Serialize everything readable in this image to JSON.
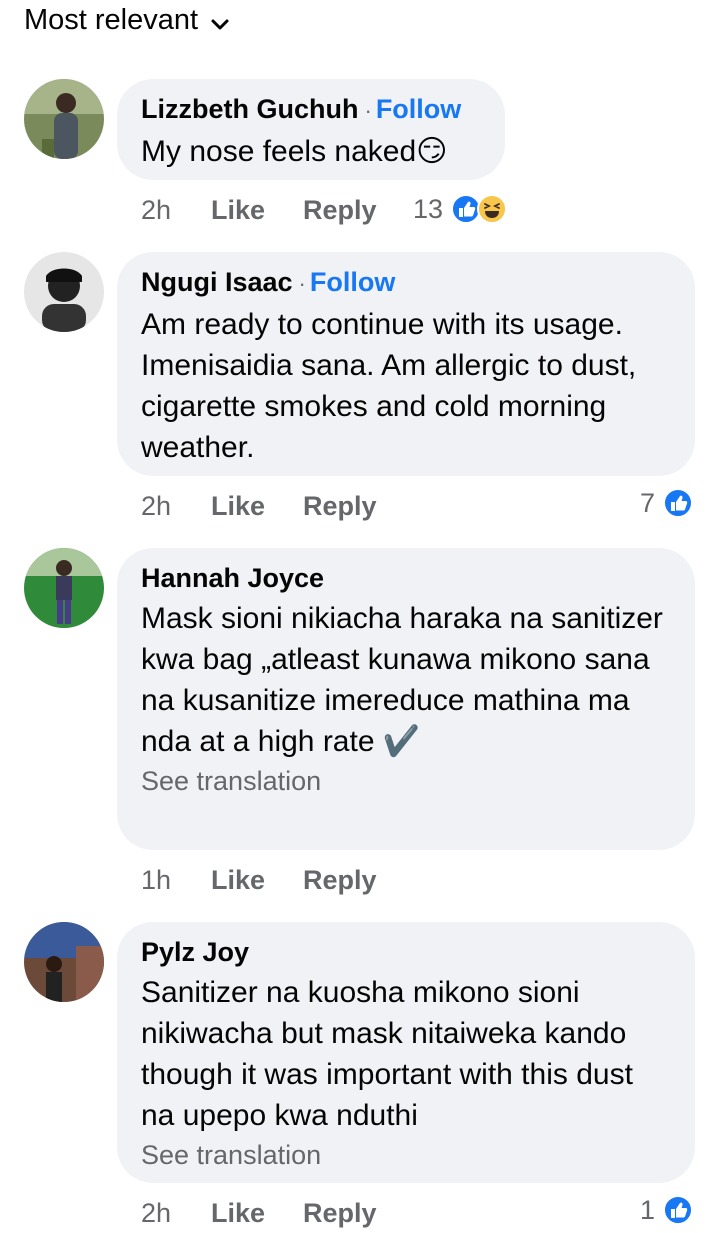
{
  "sort": {
    "label": "Most relevant",
    "icon": "chevron-down-icon"
  },
  "comments": [
    {
      "author": "Lizzbeth Guchuh",
      "follow": "Follow",
      "text": "My nose feels naked😏",
      "time": "2h",
      "like": "Like",
      "reply": "Reply",
      "reaction_count": "13",
      "reactions": [
        "like-icon",
        "haha-icon"
      ]
    },
    {
      "author": "Ngugi Isaac",
      "follow": "Follow",
      "text": "Am ready to continue with its usage. Imenisaidia sana. Am allergic to dust, cigarette smokes and cold morning weather.",
      "time": "2h",
      "like": "Like",
      "reply": "Reply",
      "reaction_count": "7",
      "reactions": [
        "like-icon"
      ]
    },
    {
      "author": "Hannah Joyce",
      "text": "Mask sioni  nikiacha haraka  na sanitizer kwa bag  „atleast  kunawa mikono sana na kusanitize imereduce mathina ma nda at a high rate ✔️",
      "see_translation": "See translation",
      "time": "1h",
      "like": "Like",
      "reply": "Reply"
    },
    {
      "author": "Pylz Joy",
      "text": "Sanitizer na kuosha mikono sioni nikiwacha but mask nitaiweka kando though it was important with this dust na upepo kwa nduthi",
      "see_translation": "See translation",
      "time": "2h",
      "like": "Like",
      "reply": "Reply",
      "reaction_count": "1",
      "reactions": [
        "like-icon"
      ]
    }
  ],
  "colors": {
    "link_blue": "#1877f2",
    "bubble_bg": "#f0f2f5",
    "secondary_text": "#65676b",
    "haha_yellow": "#f7c64b"
  }
}
